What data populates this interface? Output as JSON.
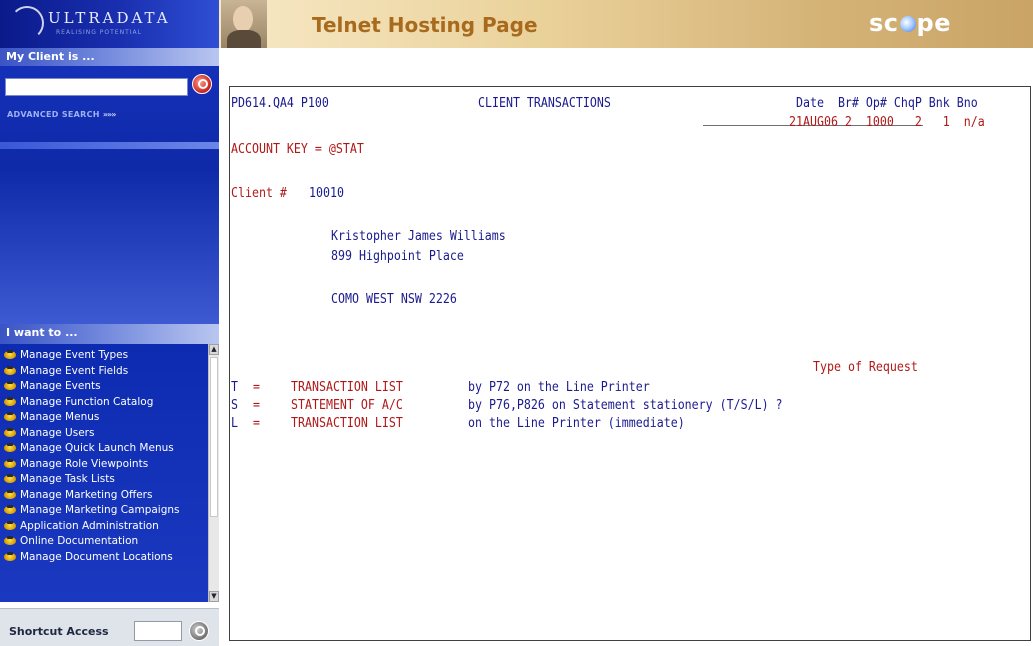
{
  "sidebar": {
    "logo_text": "ULTRADATA",
    "logo_tagline": "REALISING POTENTIAL",
    "client_section_title": "My Client is ...",
    "search": {
      "value": "",
      "placeholder": ""
    },
    "advanced_search_label": "ADVANCED SEARCH",
    "advanced_search_arrows": "»»»",
    "want_section_title": "I want to ...",
    "menu_items": [
      "Manage Event Types",
      "Manage Event Fields",
      "Manage Events",
      "Manage Function Catalog",
      "Manage Menus",
      "Manage Users",
      "Manage Quick Launch Menus",
      "Manage Role Viewpoints",
      "Manage Task Lists",
      "Manage Marketing Offers",
      "Manage Marketing Campaigns",
      "Application Administration",
      "Online Documentation",
      "Manage Document Locations"
    ],
    "shortcut_label": "Shortcut Access",
    "shortcut_value": ""
  },
  "header": {
    "title": "Telnet Hosting Page",
    "brand_left": "sc",
    "brand_right": "pe"
  },
  "terminal": {
    "program": "PD614.QA4 P100",
    "screen_title": "CLIENT TRANSACTIONS",
    "header_labels": "Date  Br# Op# ChqP Bnk Bno",
    "header_values": "21AUG06 2  1000   2   1  n/a",
    "account_key_line": "ACCOUNT KEY = @STAT",
    "client_label": "Client #",
    "client_number": "10010",
    "client_name": "Kristopher James Williams",
    "address_line1": "899 Highpoint Place",
    "address_line2": "COMO WEST NSW 2226",
    "request_heading": "Type of Request",
    "options": [
      {
        "key": "T",
        "eq": "=",
        "name": "TRANSACTION LIST",
        "desc": "by P72 on the Line Printer"
      },
      {
        "key": "S",
        "eq": "=",
        "name": "STATEMENT OF A/C",
        "desc": "by P76,P826 on Statement stationery (T/S/L) ?"
      },
      {
        "key": "L",
        "eq": "=",
        "name": "TRANSACTION LIST",
        "desc": "on the Line Printer (immediate)"
      }
    ]
  },
  "colors": {
    "sidebar_blue": "#0e2aa8",
    "header_gold": "#ead19a",
    "title_brown": "#a86a1c",
    "terminal_navy": "#1a1a8e",
    "terminal_red": "#b01818"
  }
}
